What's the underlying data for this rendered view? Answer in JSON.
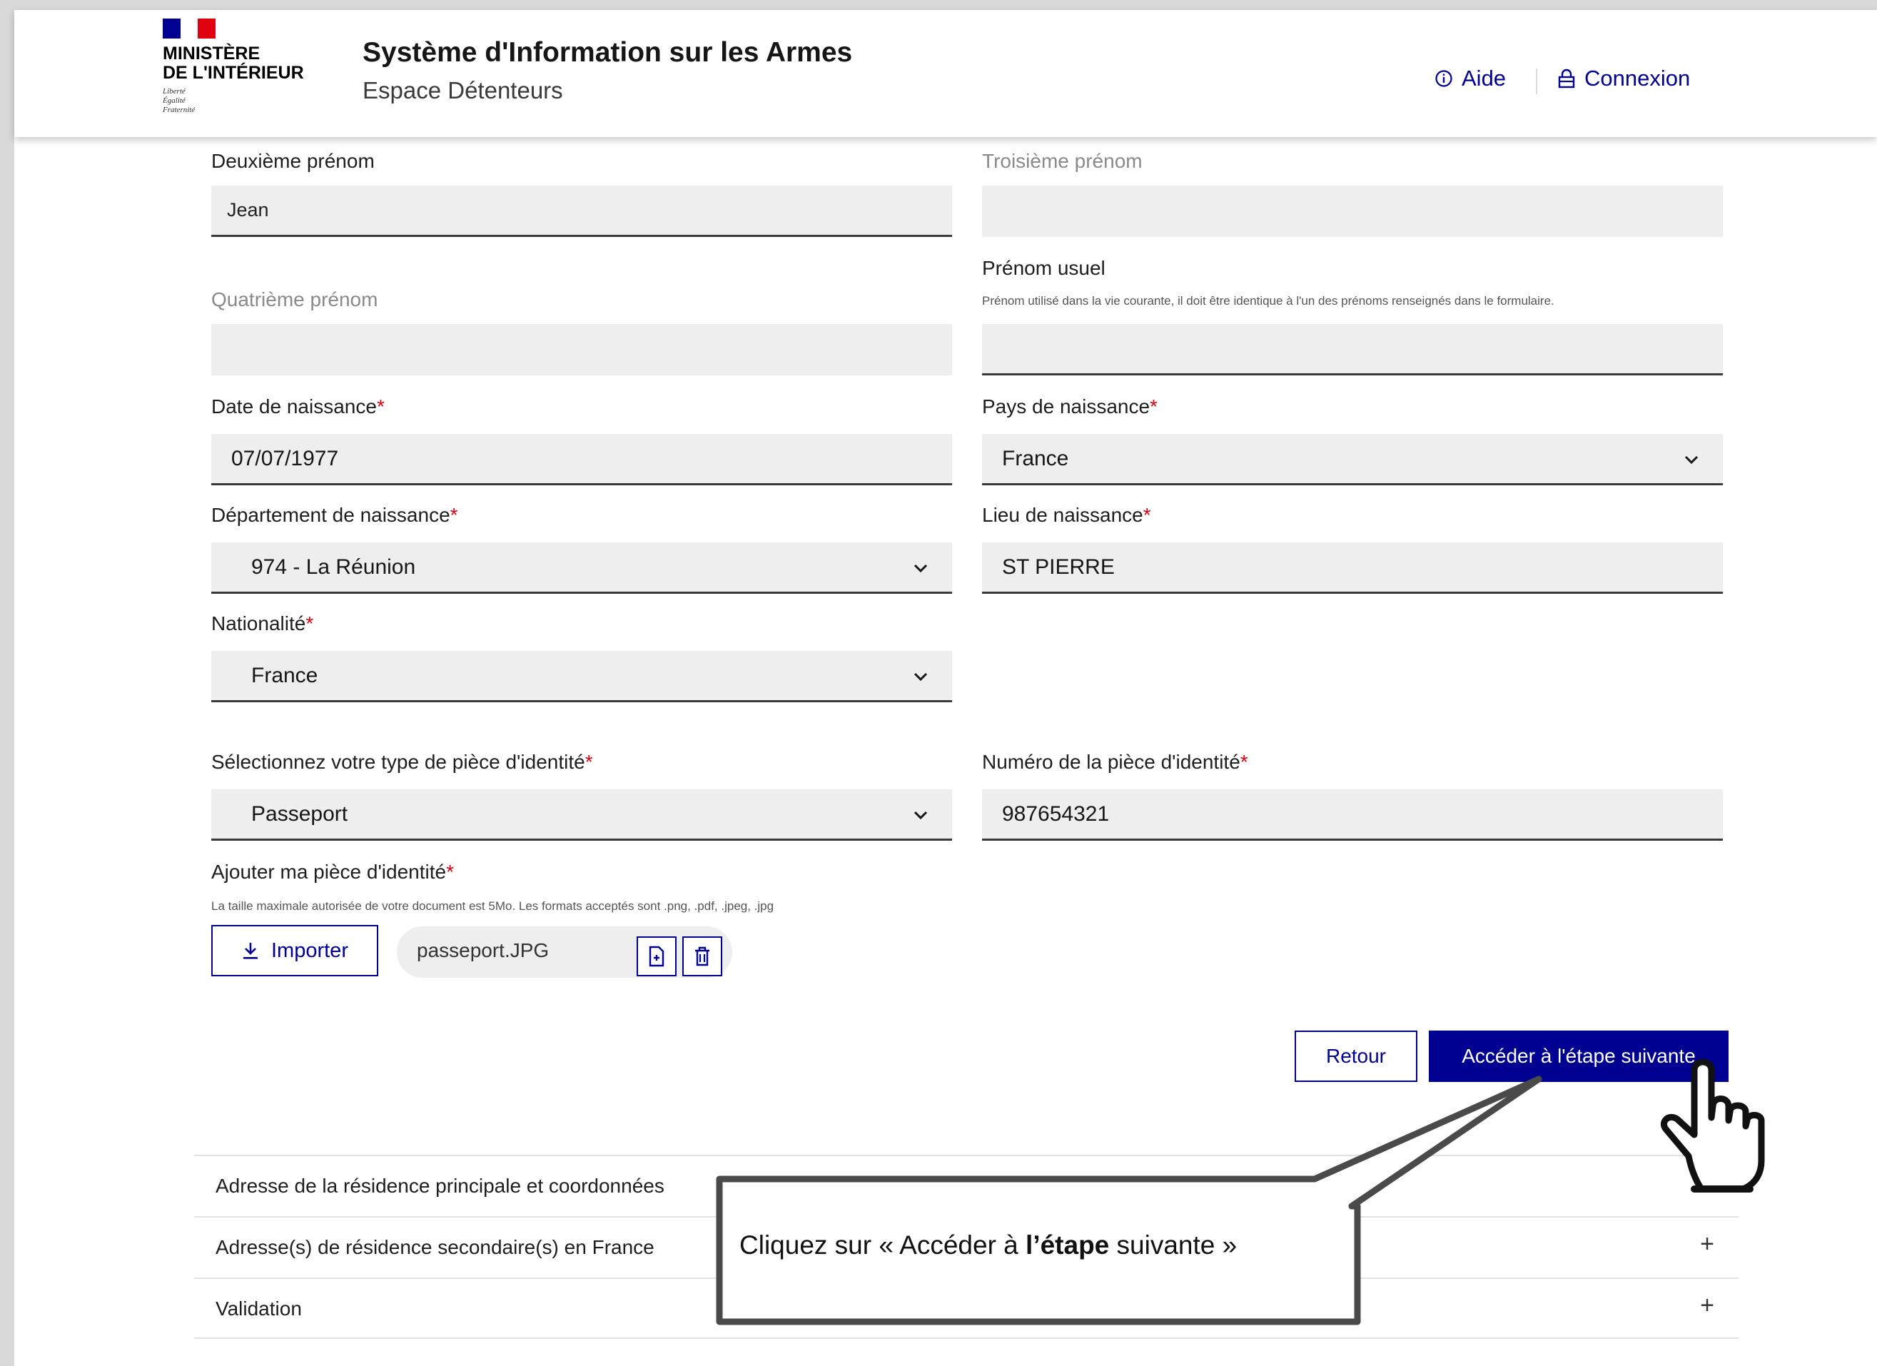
{
  "header": {
    "logo_text": "MINISTÈRE\nDE L'INTÉRIEUR",
    "logo_motto": "Liberté\nÉgalité\nFraternité",
    "title": "Système d'Information sur les Armes",
    "subtitle": "Espace Détenteurs",
    "aide_label": "Aide",
    "connexion_label": "Connexion"
  },
  "form": {
    "deuxieme_prenom": {
      "label": "Deuxième prénom",
      "value": "Jean"
    },
    "troisieme_prenom": {
      "label": "Troisième prénom",
      "value": ""
    },
    "quatrieme_prenom": {
      "label": "Quatrième prénom",
      "value": ""
    },
    "prenom_usuel": {
      "label": "Prénom usuel",
      "hint": "Prénom utilisé dans la vie courante, il doit être identique à l'un des prénoms renseignés dans le formulaire.",
      "value": ""
    },
    "date_naissance": {
      "label": "Date de naissance",
      "required_mark": "*",
      "value": "07/07/1977"
    },
    "pays_naissance": {
      "label": "Pays de naissance",
      "required_mark": "*",
      "value": "France"
    },
    "departement_naissance": {
      "label": "Département de naissance",
      "required_mark": "*",
      "value": "974 - La Réunion"
    },
    "lieu_naissance": {
      "label": "Lieu de naissance",
      "required_mark": "*",
      "value": "ST PIERRE"
    },
    "nationalite": {
      "label": "Nationalité",
      "required_mark": "*",
      "value": "France"
    },
    "type_piece": {
      "label": "Sélectionnez votre type de pièce d'identité",
      "required_mark": "*",
      "value": "Passeport"
    },
    "numero_piece": {
      "label": "Numéro de la pièce d'identité",
      "required_mark": "*",
      "value": "987654321"
    },
    "ajouter_piece": {
      "label": "Ajouter ma pièce d'identité",
      "required_mark": "*",
      "hint": "La taille maximale autorisée de votre document est 5Mo. Les formats acceptés sont .png, .pdf, .jpeg, .jpg",
      "import_label": "Importer",
      "file_name": "passeport.JPG"
    }
  },
  "actions": {
    "retour_label": "Retour",
    "next_label": "Accéder à l'étape suivante"
  },
  "accordion": [
    {
      "title": "Adresse de la résidence principale et coordonnées",
      "toggle": "+"
    },
    {
      "title": "Adresse(s) de résidence secondaire(s) en France",
      "toggle": "+"
    },
    {
      "title": "Validation",
      "toggle": "+"
    }
  ],
  "callout": {
    "text_before": "Cliquez sur « Accéder à ",
    "text_bold": "l’étape",
    "text_after": " suivante »"
  },
  "colors": {
    "primary": "#000091",
    "required": "#e1000f",
    "field_bg": "#eeeeee"
  }
}
